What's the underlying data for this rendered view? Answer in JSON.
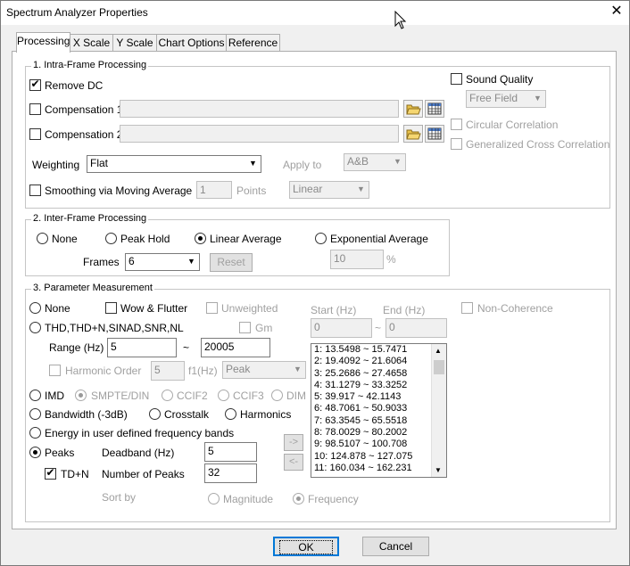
{
  "window": {
    "title": "Spectrum Analyzer Properties",
    "close_glyph": "✕"
  },
  "tabs": [
    "Processing",
    "X Scale",
    "Y Scale",
    "Chart Options",
    "Reference"
  ],
  "intra": {
    "label": "1. Intra-Frame Processing",
    "remove_dc": "Remove DC",
    "comp1": "Compensation 1",
    "comp2": "Compensation 2",
    "weighting_label": "Weighting",
    "weighting_value": "Flat",
    "apply_to_label": "Apply to",
    "apply_to_value": "A&B",
    "smoothing_label": "Smoothing via Moving Average",
    "smoothing_value": "1",
    "points_label": "Points",
    "smoothing_type": "Linear",
    "sound_quality": "Sound Quality",
    "sound_field": "Free Field",
    "circular": "Circular Correlation",
    "gcc": "Generalized Cross Correlation"
  },
  "inter": {
    "label": "2. Inter-Frame Processing",
    "none": "None",
    "peak_hold": "Peak Hold",
    "linear": "Linear Average",
    "exponential": "Exponential Average",
    "frames_label": "Frames",
    "frames_value": "6",
    "reset": "Reset",
    "exp_value": "10",
    "percent": "%"
  },
  "param": {
    "label": "3. Parameter Measurement",
    "none": "None",
    "wow": "Wow & Flutter",
    "unweighted": "Unweighted",
    "start_label": "Start (Hz)",
    "end_label": "End (Hz)",
    "start_value": "0",
    "end_value": "0",
    "tilde": "~",
    "non_coherence": "Non-Coherence",
    "thd": "THD,THD+N,SINAD,SNR,NL",
    "gm": "Gm",
    "range_label": "Range (Hz)",
    "range_start": "5",
    "range_end": "20005",
    "harmonic_order": "Harmonic Order",
    "harmonic_value": "5",
    "f1_label": "f1(Hz)",
    "f1_value": "Peak",
    "imd": "IMD",
    "smpte": "SMPTE/DIN",
    "ccif2": "CCIF2",
    "ccif3": "CCIF3",
    "dim": "DIM",
    "bandwidth": "Bandwidth (-3dB)",
    "crosstalk": "Crosstalk",
    "harmonics": "Harmonics",
    "energy": "Energy in user defined frequency bands",
    "peaks": "Peaks",
    "deadband_label": "Deadband (Hz)",
    "deadband_value": "5",
    "tdn": "TD+N",
    "num_peaks_label": "Number of Peaks",
    "num_peaks_value": "32",
    "sort_by": "Sort by",
    "magnitude": "Magnitude",
    "frequency": "Frequency",
    "arrow_right": "->",
    "arrow_left": "<-",
    "bands": [
      "1: 13.5498 ~ 15.7471",
      "2: 19.4092 ~ 21.6064",
      "3: 25.2686 ~ 27.4658",
      "4: 31.1279 ~ 33.3252",
      "5: 39.917 ~ 42.1143",
      "6: 48.7061 ~ 50.9033",
      "7: 63.3545 ~ 65.5518",
      "8: 78.0029 ~ 80.2002",
      "9: 98.5107 ~ 100.708",
      "10: 124.878 ~ 127.075",
      "11: 160.034 ~ 162.231"
    ]
  },
  "footer": {
    "ok": "OK",
    "cancel": "Cancel"
  },
  "colors": {
    "accent": "#0078d7",
    "disabled": "#a0a0a0"
  }
}
